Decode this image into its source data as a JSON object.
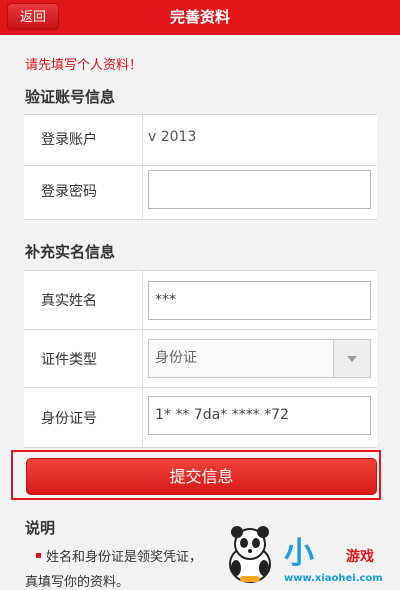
{
  "header": {
    "back_label": "返回",
    "title": "完善资料"
  },
  "notice": "请先填写个人资料！",
  "account_section": {
    "title": "验证账号信息",
    "login_account_label": "登录账户",
    "login_account_value": "v      2013",
    "login_password_label": "登录密码",
    "login_password_value": ""
  },
  "realname_section": {
    "title": "补充实名信息",
    "real_name_label": "真实姓名",
    "real_name_value": "***",
    "id_type_label": "证件类型",
    "id_type_value": "身份证",
    "id_number_label": "身份证号",
    "id_number_value": "1*  **   7da*   ****  *72"
  },
  "submit_label": "提交信息",
  "explain": {
    "title": "说明",
    "line1": "姓名和身份证是领奖凭证，",
    "line2": "真填写你的资料。"
  },
  "watermark": {
    "big": "小",
    "small": "游戏",
    "url": "www.xiaohei.com"
  },
  "colors": {
    "brand_red": "#e0161a",
    "watermark_blue": "#1a9de0"
  }
}
